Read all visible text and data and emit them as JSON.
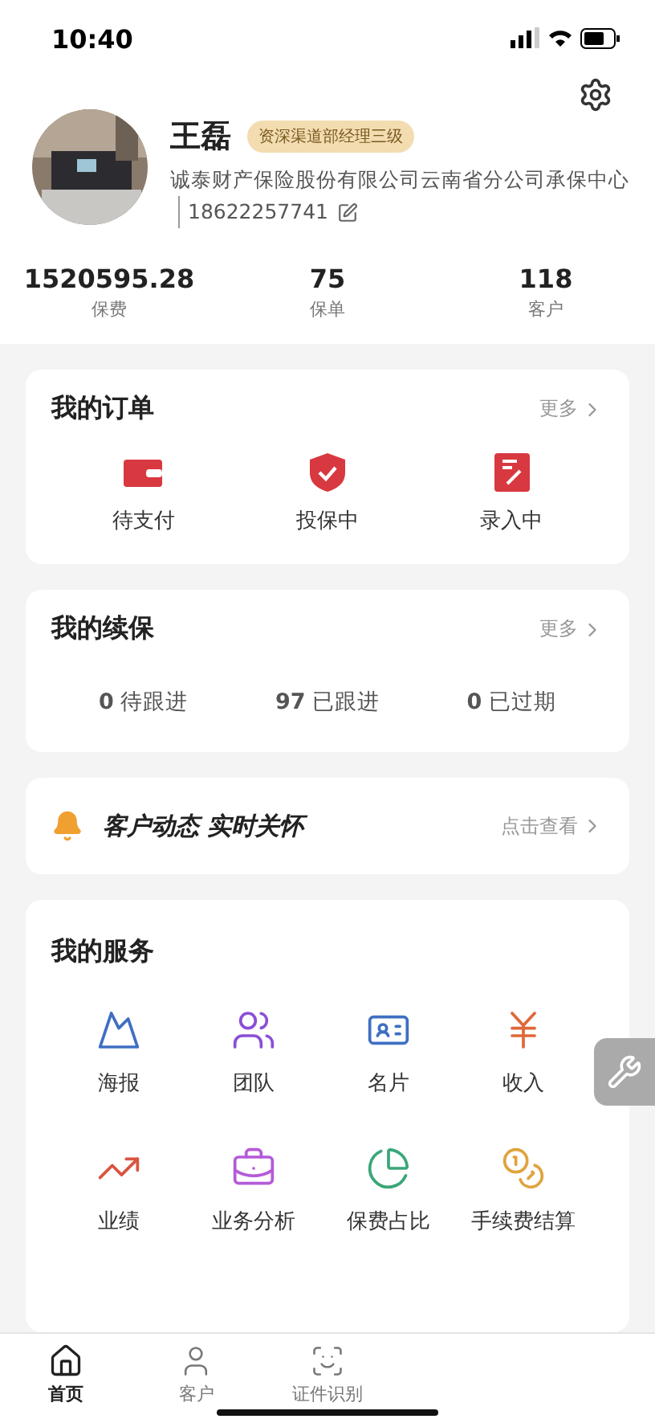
{
  "status_bar": {
    "time": "10:40"
  },
  "profile": {
    "name": "王磊",
    "badge": "资深渠道部经理三级",
    "company": "诚泰财产保险股份有限公司云南省分公司承保中心",
    "phone": "18622257741"
  },
  "stats": [
    {
      "value": "1520595.28",
      "label": "保费"
    },
    {
      "value": "75",
      "label": "保单"
    },
    {
      "value": "118",
      "label": "客户"
    }
  ],
  "orders": {
    "title": "我的订单",
    "more": "更多",
    "items": [
      {
        "label": "待支付"
      },
      {
        "label": "投保中"
      },
      {
        "label": "录入中"
      }
    ]
  },
  "renewals": {
    "title": "我的续保",
    "more": "更多",
    "items": [
      {
        "count": "0",
        "label": "待跟进"
      },
      {
        "count": "97",
        "label": "已跟进"
      },
      {
        "count": "0",
        "label": "已过期"
      }
    ]
  },
  "notice": {
    "text": "客户动态 实时关怀",
    "action": "点击查看"
  },
  "services": {
    "title": "我的服务",
    "items": [
      {
        "label": "海报",
        "color": "#3f6fc4"
      },
      {
        "label": "团队",
        "color": "#8a4fd6"
      },
      {
        "label": "名片",
        "color": "#3f6fc4"
      },
      {
        "label": "收入",
        "color": "#e0683a"
      },
      {
        "label": "业绩",
        "color": "#d9533f"
      },
      {
        "label": "业务分析",
        "color": "#b45ad8"
      },
      {
        "label": "保费占比",
        "color": "#3aa678"
      },
      {
        "label": "手续费结算",
        "color": "#e0a33f"
      }
    ]
  },
  "tab_bar": [
    {
      "label": "首页",
      "selected": true
    },
    {
      "label": "客户",
      "selected": false
    },
    {
      "label": "证件识别",
      "selected": false
    }
  ]
}
